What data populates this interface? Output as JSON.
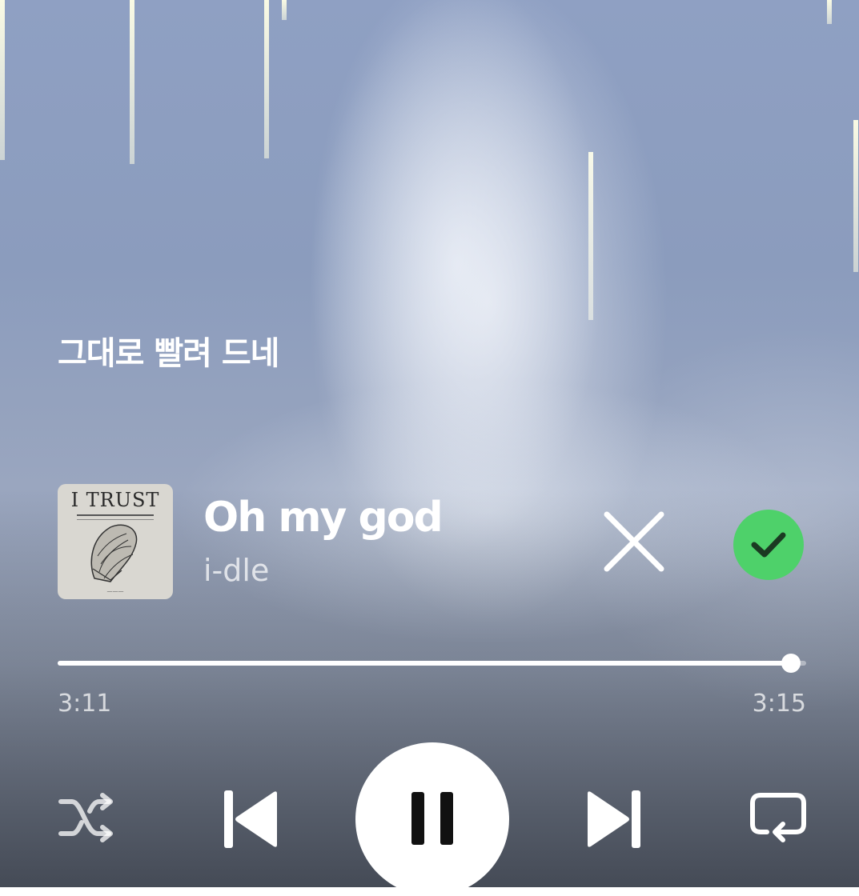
{
  "lyric": {
    "current_line": "그대로 빨려 드네"
  },
  "track": {
    "album_art_text": "I TRUST",
    "title": "Oh my god",
    "artist": "i-dle"
  },
  "actions": {
    "reject_icon": "close-icon",
    "accept_icon": "check-circle-icon",
    "accept_color": "#4ed16a"
  },
  "playback": {
    "elapsed": "3:11",
    "duration": "3:15",
    "progress_fraction": 0.98,
    "state": "playing"
  },
  "controls": {
    "shuffle_icon": "shuffle-icon",
    "previous_icon": "skip-previous-icon",
    "pause_icon": "pause-icon",
    "next_icon": "skip-next-icon",
    "repeat_icon": "repeat-icon"
  }
}
